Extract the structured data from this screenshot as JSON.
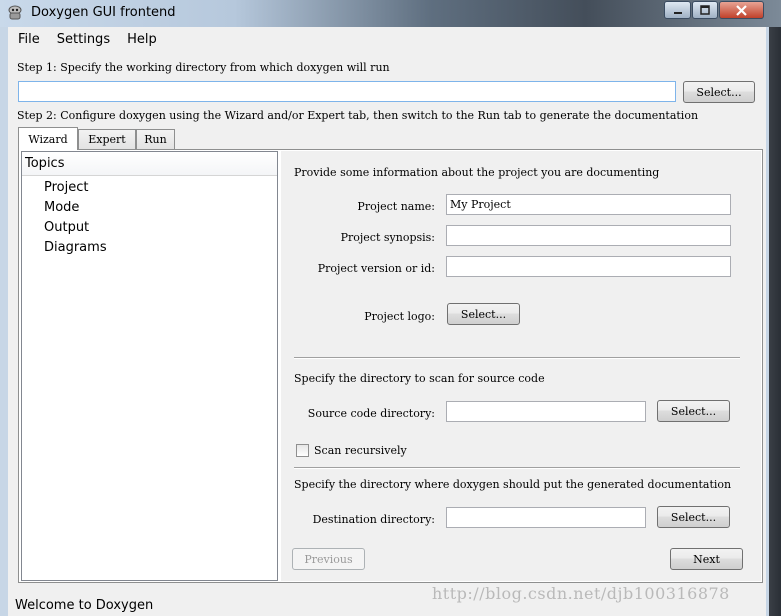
{
  "window": {
    "title": "Doxygen GUI frontend",
    "app_icon": "doxygen-logo-icon",
    "controls": {
      "minimize": "minimize-icon",
      "maximize": "maximize-icon",
      "close": "close-icon"
    }
  },
  "menu": [
    "File",
    "Settings",
    "Help"
  ],
  "step1": {
    "label": "Step 1: Specify the working directory from which doxygen will run",
    "value": "",
    "select_label": "Select..."
  },
  "step2": {
    "label": "Step 2: Configure doxygen using the Wizard and/or Expert tab, then switch to the Run tab to generate the documentation"
  },
  "tabs": [
    {
      "label": "Wizard",
      "active": true
    },
    {
      "label": "Expert",
      "active": false
    },
    {
      "label": "Run",
      "active": false
    }
  ],
  "topics": {
    "header": "Topics",
    "items": [
      "Project",
      "Mode",
      "Output",
      "Diagrams"
    ]
  },
  "project": {
    "intro": "Provide some information about the project you are documenting",
    "name_label": "Project name:",
    "name_value": "My Project",
    "synopsis_label": "Project synopsis:",
    "synopsis_value": "",
    "version_label": "Project version or id:",
    "version_value": "",
    "logo_label": "Project logo:",
    "logo_button": "Select..."
  },
  "source": {
    "heading": "Specify the directory to scan for source code",
    "dir_label": "Source code directory:",
    "dir_value": "",
    "select_label": "Select...",
    "recursive_label": "Scan recursively",
    "recursive_checked": false
  },
  "destination": {
    "heading": "Specify the directory where doxygen should put the generated documentation",
    "dir_label": "Destination directory:",
    "dir_value": "",
    "select_label": "Select..."
  },
  "nav": {
    "previous": "Previous",
    "next": "Next"
  },
  "status": "Welcome to Doxygen",
  "watermark": "http://blog.csdn.net/djb100316878"
}
